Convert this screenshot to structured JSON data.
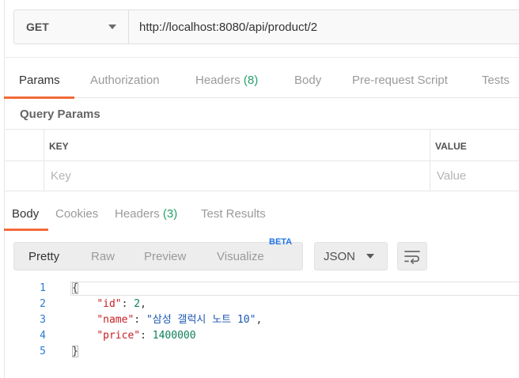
{
  "request": {
    "method": "GET",
    "url": "http://localhost:8080/api/product/2"
  },
  "request_tabs": [
    {
      "label": "Params",
      "count": "",
      "active": true
    },
    {
      "label": "Authorization",
      "count": "",
      "active": false
    },
    {
      "label": "Headers",
      "count": "(8)",
      "active": false
    },
    {
      "label": "Body",
      "count": "",
      "active": false
    },
    {
      "label": "Pre-request Script",
      "count": "",
      "active": false
    },
    {
      "label": "Tests",
      "count": "",
      "active": false
    }
  ],
  "query_params": {
    "title": "Query Params",
    "columns": [
      "KEY",
      "VALUE"
    ],
    "placeholders": {
      "key": "Key",
      "value": "Value"
    }
  },
  "response_tabs": [
    {
      "label": "Body",
      "count": "",
      "active": true
    },
    {
      "label": "Cookies",
      "count": "",
      "active": false
    },
    {
      "label": "Headers",
      "count": "(3)",
      "active": false
    },
    {
      "label": "Test Results",
      "count": "",
      "active": false
    }
  ],
  "view_modes": [
    {
      "label": "Pretty",
      "active": true
    },
    {
      "label": "Raw",
      "active": false
    },
    {
      "label": "Preview",
      "active": false
    },
    {
      "label": "Visualize",
      "active": false,
      "badge": "BETA"
    }
  ],
  "format": "JSON",
  "response_body": {
    "lines": [
      {
        "no": "1",
        "open": "{"
      },
      {
        "no": "2",
        "indent": "    ",
        "key": "\"id\"",
        "sep": ": ",
        "value": "2",
        "type": "num",
        "end": ","
      },
      {
        "no": "3",
        "indent": "    ",
        "key": "\"name\"",
        "sep": ": ",
        "value": "\"삼성 갤럭시 노트 10\"",
        "type": "str",
        "end": ","
      },
      {
        "no": "4",
        "indent": "    ",
        "key": "\"price\"",
        "sep": ": ",
        "value": "1400000",
        "type": "num",
        "end": ""
      },
      {
        "no": "5",
        "close": "}"
      }
    ]
  },
  "colors": {
    "accent": "#f26b3a",
    "count_green": "#26a069",
    "line_number": "#2c7bd1",
    "json_key": "#c81e24",
    "json_string": "#1a55b0",
    "json_number": "#0f7f5a",
    "beta": "#1f73e8"
  },
  "icons": {
    "method_dropdown": "chevron-down-icon",
    "format_dropdown": "chevron-down-icon",
    "wrap": "wrap-lines-icon"
  }
}
